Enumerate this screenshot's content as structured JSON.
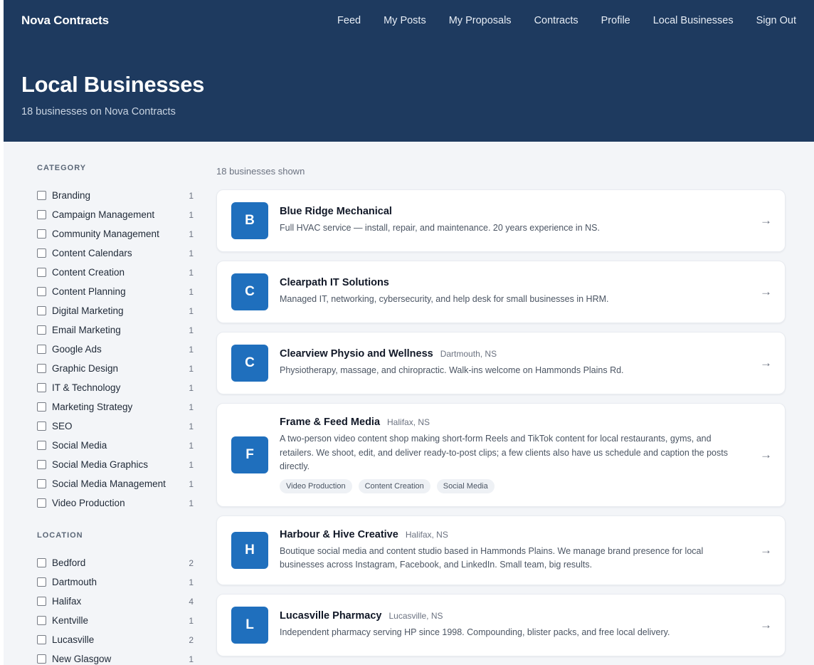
{
  "header": {
    "brand": "Nova Contracts",
    "nav": [
      "Feed",
      "My Posts",
      "My Proposals",
      "Contracts",
      "Profile",
      "Local Businesses",
      "Sign Out"
    ],
    "title": "Local Businesses",
    "subtitle": "18 businesses on Nova Contracts"
  },
  "filters": {
    "category_title": "CATEGORY",
    "categories": [
      {
        "label": "Branding",
        "count": "1"
      },
      {
        "label": "Campaign Management",
        "count": "1"
      },
      {
        "label": "Community Management",
        "count": "1"
      },
      {
        "label": "Content Calendars",
        "count": "1"
      },
      {
        "label": "Content Creation",
        "count": "1"
      },
      {
        "label": "Content Planning",
        "count": "1"
      },
      {
        "label": "Digital Marketing",
        "count": "1"
      },
      {
        "label": "Email Marketing",
        "count": "1"
      },
      {
        "label": "Google Ads",
        "count": "1"
      },
      {
        "label": "Graphic Design",
        "count": "1"
      },
      {
        "label": "IT & Technology",
        "count": "1"
      },
      {
        "label": "Marketing Strategy",
        "count": "1"
      },
      {
        "label": "SEO",
        "count": "1"
      },
      {
        "label": "Social Media",
        "count": "1"
      },
      {
        "label": "Social Media Graphics",
        "count": "1"
      },
      {
        "label": "Social Media Management",
        "count": "1"
      },
      {
        "label": "Video Production",
        "count": "1"
      }
    ],
    "location_title": "LOCATION",
    "locations": [
      {
        "label": "Bedford",
        "count": "2"
      },
      {
        "label": "Dartmouth",
        "count": "1"
      },
      {
        "label": "Halifax",
        "count": "4"
      },
      {
        "label": "Kentville",
        "count": "1"
      },
      {
        "label": "Lucasville",
        "count": "2"
      },
      {
        "label": "New Glasgow",
        "count": "1"
      }
    ]
  },
  "results": {
    "count_text": "18 businesses shown",
    "arrow": "→",
    "businesses": [
      {
        "initial": "B",
        "name": "Blue Ridge Mechanical",
        "location": "",
        "description": "Full HVAC service — install, repair, and maintenance. 20 years experience in NS.",
        "tags": []
      },
      {
        "initial": "C",
        "name": "Clearpath IT Solutions",
        "location": "",
        "description": "Managed IT, networking, cybersecurity, and help desk for small businesses in HRM.",
        "tags": []
      },
      {
        "initial": "C",
        "name": "Clearview Physio and Wellness",
        "location": "Dartmouth, NS",
        "description": "Physiotherapy, massage, and chiropractic. Walk-ins welcome on Hammonds Plains Rd.",
        "tags": []
      },
      {
        "initial": "F",
        "name": "Frame & Feed Media",
        "location": "Halifax, NS",
        "description": "A two-person video content shop making short-form Reels and TikTok content for local restaurants, gyms, and retailers. We shoot, edit, and deliver ready-to-post clips; a few clients also have us schedule and caption the posts directly.",
        "tags": [
          "Video Production",
          "Content Creation",
          "Social Media"
        ]
      },
      {
        "initial": "H",
        "name": "Harbour & Hive Creative",
        "location": "Halifax, NS",
        "description": "Boutique social media and content studio based in Hammonds Plains. We manage brand presence for local businesses across Instagram, Facebook, and LinkedIn. Small team, big results.",
        "tags": []
      },
      {
        "initial": "L",
        "name": "Lucasville Pharmacy",
        "location": "Lucasville, NS",
        "description": "Independent pharmacy serving HP since 1998. Compounding, blister packs, and free local delivery.",
        "tags": []
      }
    ]
  },
  "colors": {
    "header_bg": "#1e3a5f",
    "avatar_bg": "#1f6fbd",
    "page_bg": "#f3f5f8"
  }
}
